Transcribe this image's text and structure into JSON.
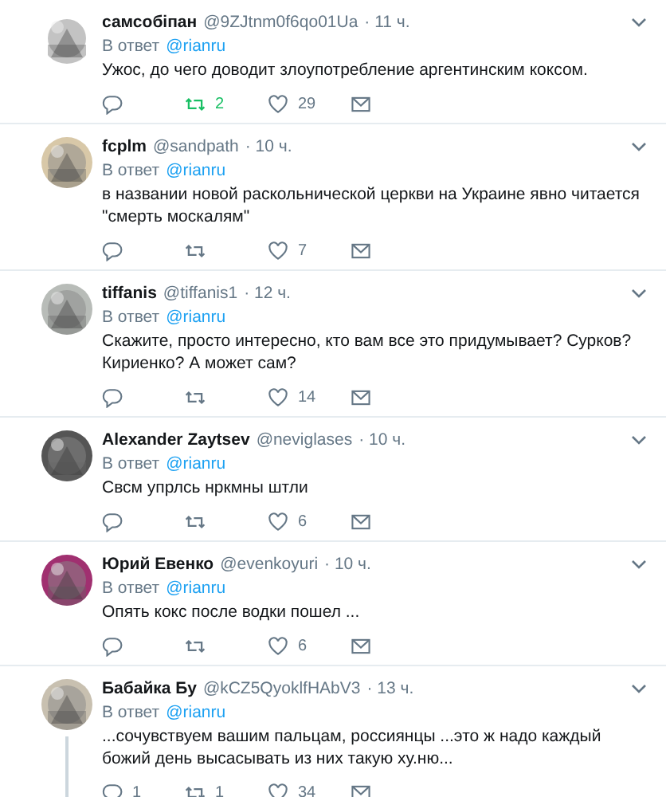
{
  "tweets": [
    {
      "name": "самсобіпан",
      "handle": "@9ZJtnm0f6qo01Ua",
      "time": "· 11 ч.",
      "reply_label": "В ответ",
      "reply_to": "@rianru",
      "text": "Ужос, до чего доводит злоупотребление аргентинским коксом.",
      "retweets": "2",
      "likes": "29",
      "retweeted": true,
      "thread": false
    },
    {
      "name": "fcplm",
      "handle": "@sandpath",
      "time": "· 10 ч.",
      "reply_label": "В ответ",
      "reply_to": "@rianru",
      "text": "в названии новой раскольнической церкви на Украине явно читается \"смерть москалям\"",
      "likes": "7",
      "retweeted": false,
      "thread": false
    },
    {
      "name": "tiffanis",
      "handle": "@tiffanis1",
      "time": "· 12 ч.",
      "reply_label": "В ответ",
      "reply_to": "@rianru",
      "text": "Скажите, просто интересно, кто вам все это придумывает? Сурков? Кириенко? А может сам?",
      "likes": "14",
      "retweeted": false,
      "thread": false
    },
    {
      "name": "Alexander Zaytsev",
      "handle": "@neviglases",
      "time": "· 10 ч.",
      "reply_label": "В ответ",
      "reply_to": "@rianru",
      "text": "Свсм упрлсь нркмны штли",
      "likes": "6",
      "retweeted": false,
      "thread": false
    },
    {
      "name": "Юрий Евенко",
      "handle": "@evenkoyuri",
      "time": "· 10 ч.",
      "reply_label": "В ответ",
      "reply_to": "@rianru",
      "text": "Опять кокс после водки пошел ...",
      "likes": "6",
      "retweeted": false,
      "thread": false
    },
    {
      "name": "Бабайка Бу",
      "handle": "@kCZ5QyoklfHAbV3",
      "time": "· 13 ч.",
      "reply_label": "В ответ",
      "reply_to": "@rianru",
      "text": "...сочувствуем вашим пальцам, россиянцы ...это ж надо каждый божий день высасывать из них  такую ху.ню...",
      "replies": "1",
      "retweets": "1",
      "likes": "34",
      "retweeted": false,
      "thread": true
    }
  ]
}
